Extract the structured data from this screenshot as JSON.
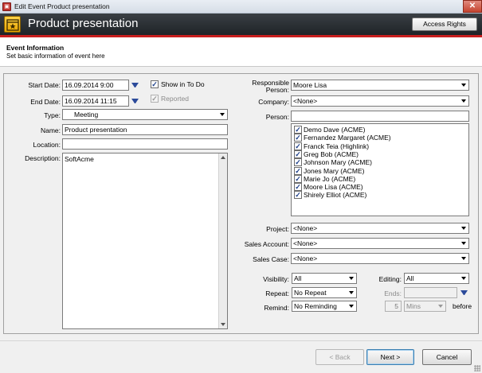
{
  "window": {
    "title": "Edit Event Product presentation"
  },
  "header": {
    "title": "Product presentation",
    "access_rights_label": "Access Rights"
  },
  "info": {
    "heading": "Event Information",
    "subheading": "Set basic information of event here"
  },
  "form": {
    "start_date_label": "Start Date:",
    "start_date_value": "16.09.2014 9:00",
    "end_date_label": "End Date:",
    "end_date_value": "16.09.2014 11:15",
    "show_in_todo_label": "Show in To Do",
    "show_in_todo_checked": true,
    "reported_label": "Reported",
    "reported_checked": true,
    "type_label": "Type:",
    "type_value": "Meeting",
    "name_label": "Name:",
    "name_value": "Product presentation",
    "location_label": "Location:",
    "location_value": "",
    "description_label": "Description:",
    "description_value": "SoftAcme",
    "responsible_label_1": "Responsible",
    "responsible_label_2": "Person:",
    "responsible_value": "Moore Lisa",
    "company_label": "Company:",
    "company_value": "<None>",
    "person_label": "Person:",
    "person_value": "",
    "persons": [
      "Demo Dave (ACME)",
      "Fernandez Margaret (ACME)",
      "Franck Teia (Highlink)",
      "Greg Bob (ACME)",
      "Johnson Mary (ACME)",
      "Jones Mary (ACME)",
      "Marie Jo (ACME)",
      "Moore Lisa (ACME)",
      "Shirely Elliot (ACME)"
    ],
    "project_label": "Project:",
    "project_value": "<None>",
    "sales_account_label": "Sales Account:",
    "sales_account_value": "<None>",
    "sales_case_label": "Sales Case:",
    "sales_case_value": "<None>",
    "visibility_label": "Visibility:",
    "visibility_value": "All",
    "editing_label": "Editing:",
    "editing_value": "All",
    "repeat_label": "Repeat:",
    "repeat_value": "No Repeat",
    "ends_label": "Ends:",
    "ends_value": "",
    "remind_label": "Remind:",
    "remind_value": "No Reminding",
    "remind_amount": "5",
    "remind_unit": "Mins",
    "before_label": "before"
  },
  "buttons": {
    "back": "< Back",
    "next": "Next >",
    "cancel": "Cancel"
  },
  "colors": {
    "header_bg": "#1f2327",
    "accent_red": "#c81e1e",
    "date_arrow": "#2b4a9a"
  }
}
